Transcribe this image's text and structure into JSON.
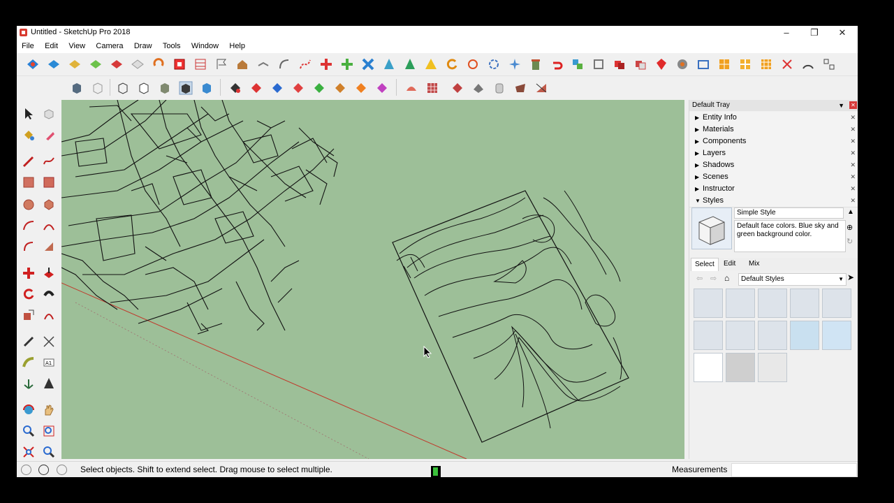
{
  "window": {
    "title": "Untitled - SketchUp Pro 2018"
  },
  "menu": [
    "File",
    "Edit",
    "View",
    "Camera",
    "Draw",
    "Tools",
    "Window",
    "Help"
  ],
  "tray": {
    "title": "Default Tray",
    "panels": [
      {
        "label": "Entity Info",
        "expanded": false
      },
      {
        "label": "Materials",
        "expanded": false
      },
      {
        "label": "Components",
        "expanded": false
      },
      {
        "label": "Layers",
        "expanded": false
      },
      {
        "label": "Shadows",
        "expanded": false
      },
      {
        "label": "Scenes",
        "expanded": false
      },
      {
        "label": "Instructor",
        "expanded": false
      },
      {
        "label": "Styles",
        "expanded": true
      }
    ],
    "styles": {
      "name": "Simple Style",
      "description": "Default face colors. Blue sky and green background color.",
      "tabs": [
        "Select",
        "Edit",
        "Mix"
      ],
      "active_tab": "Select",
      "library": "Default Styles",
      "thumb_count": 13
    }
  },
  "status": {
    "message": "Select objects. Shift to extend select. Drag mouse to select multiple.",
    "measurements_label": "Measurements",
    "measurements_value": ""
  },
  "colors": {
    "viewport_bg": "#9dbf98",
    "axis_red": "#c0392b",
    "accent": "#1e73c8"
  }
}
